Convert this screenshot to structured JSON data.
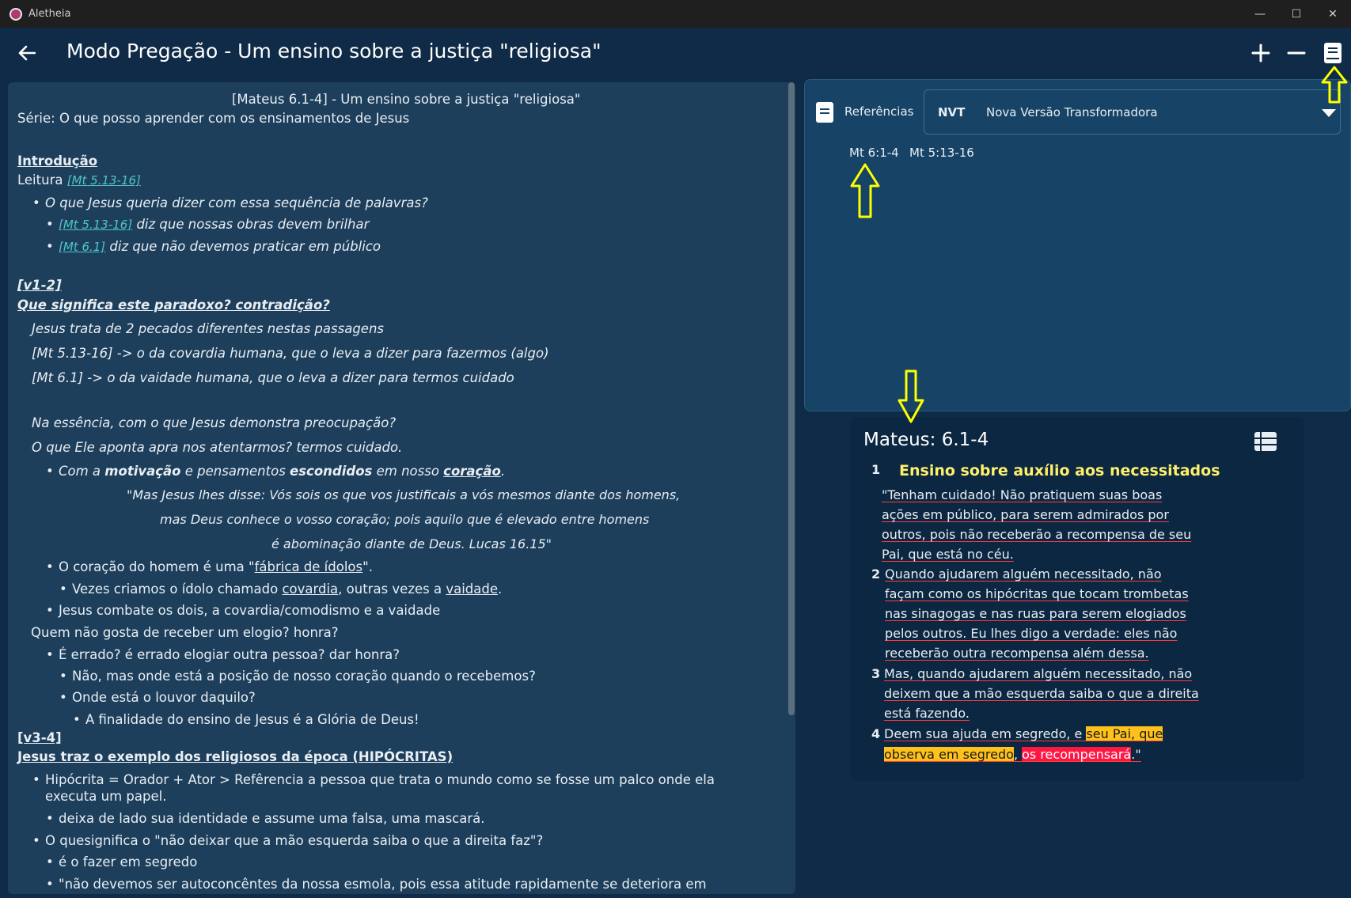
{
  "window": {
    "app_name": "Aletheia",
    "minimize": "—",
    "maximize": "☐",
    "close": "✕"
  },
  "header": {
    "title": "Modo Pregação - Um ensino sobre a justiça \"religiosa\"",
    "back_icon": "arrow-left-icon",
    "add_icon": "plus-icon",
    "remove_icon": "minus-icon",
    "book_icon": "book-icon"
  },
  "editor": {
    "heading": "[Mateus 6.1-4] - Um ensino sobre a justiça \"religiosa\"",
    "series": "Série: O que posso aprender com os ensinamentos de Jesus",
    "intro_title": "Introdução",
    "leitura_label": "Leitura ",
    "leitura_link": "[Mt 5.13-16]",
    "q1": "O que Jesus queria dizer com essa sequência de palavras?",
    "q1a_link": "[Mt 5.13-16]",
    "q1a_text": " diz que nossas obras devem brilhar",
    "q1b_link": "[Mt 6.1]",
    "q1b_text": " diz que não devemos praticar em público",
    "v12": "[v1-2]",
    "paradox": "Que significa este paradoxo? contradição?",
    "p1": "Jesus trata de 2 pecados diferentes nestas passagens",
    "p2": "[Mt 5.13-16] -> o da covardia humana, que o leva a dizer para fazermos (algo)",
    "p3": "[Mt 6.1] -> o da vaidade humana, que o leva a dizer para termos cuidado",
    "p4": "Na essência, com o que Jesus demonstra preocupação?",
    "p5": "O que Ele aponta apra nos atentarmos? termos cuidado.",
    "m1": "Com a ",
    "m2": "motivação",
    "m3": " e pensamentos ",
    "m4": "escondidos",
    "m5": " em nosso ",
    "m6": "coração",
    "m7": ".",
    "quote1": "\"Mas Jesus lhes disse: Vós sois os que vos justificais a vós mesmos diante dos homens,",
    "quote2": "mas Deus conhece o vosso coração; pois aquilo que é elevado entre homens",
    "quote3": "é abominação diante de Deus. Lucas 16.15\"",
    "c1a": "O coração do homem é uma \"",
    "c1b": "fábrica de ídolos",
    "c1c": "\".",
    "c2a": "Vezes criamos o ídolo chamado ",
    "c2b": "covardia",
    "c2c": ", outras vezes a ",
    "c2d": "vaidade",
    "c2e": ".",
    "c3": "Jesus combate os dois, a covardia/comodismo e a vaidade",
    "e1": "Quem não gosta de receber um elogio? honra?",
    "e2": "É errado? é errado elogiar outra pessoa? dar honra?",
    "e3": "Não, mas onde está a posição de nosso coração quando o recebemos?",
    "e4": "Onde está o louvor daquilo?",
    "e5": "A finalidade do ensino de Jesus é a Glória de Deus!",
    "v34": "[v3-4]",
    "hip_title": "Jesus traz o exemplo dos religiosos da época (HIPÓCRITAS)",
    "h1a": "Hipócrita = Orador + Ator > Refêrencia a pessoa que trata o mundo como se fosse um palco onde ela",
    "h1b": "executa um papel.",
    "h2": "deixa de lado sua identidade e assume uma falsa, uma mascará.",
    "h3": "O quesignifica o \"não deixar que a mão esquerda saiba o que a direita faz\"?",
    "h4": "é o fazer em segredo",
    "h5": "\"não devemos ser autoconcêntes da nossa esmola, pois essa atitude rapidamente se deteriora em"
  },
  "references": {
    "label": "Referências",
    "version_code": "NVT",
    "version_name": "Nova Versão Transformadora",
    "chips": [
      "Mt 6:1-4",
      "Mt 5:13-16"
    ]
  },
  "verse": {
    "reference": "Mateus: 6.1-4",
    "heading": "Ensino sobre auxílio aos necessitados",
    "n1": "1",
    "v1": [
      "\"Tenham cuidado! Não pratiquem suas boas",
      "ações em público, para serem admirados por",
      "outros, pois não receberão a recompensa de seu",
      "Pai, que está no céu."
    ],
    "n2": "2",
    "v2": [
      "Quando ajudarem alguém necessitado, não",
      "façam como os hipócritas que tocam trombetas",
      "nas sinagogas e nas ruas para serem elogiados",
      "pelos outros. Eu lhes digo a verdade: eles não",
      "receberão outra recompensa além dessa."
    ],
    "n3": "3",
    "v3": [
      "Mas, quando ajudarem alguém necessitado, não",
      "deixem que a mão esquerda saiba o que a direita",
      "está fazendo."
    ],
    "n4": "4",
    "v4a": "Deem sua ajuda em segredo, e ",
    "v4b": "seu Pai, que",
    "v4c": "observa em segredo",
    "v4d": ", ",
    "v4e": "os recompensará",
    "v4f": ".\""
  },
  "colors": {
    "background": "#0f2b47",
    "editor": "#1d3f5c",
    "link": "#4fc3c8",
    "verse_heading": "#fff06a",
    "highlight_yellow": "#ffc21a",
    "highlight_red": "#ff1744",
    "annotation_arrow": "#ffff00"
  }
}
